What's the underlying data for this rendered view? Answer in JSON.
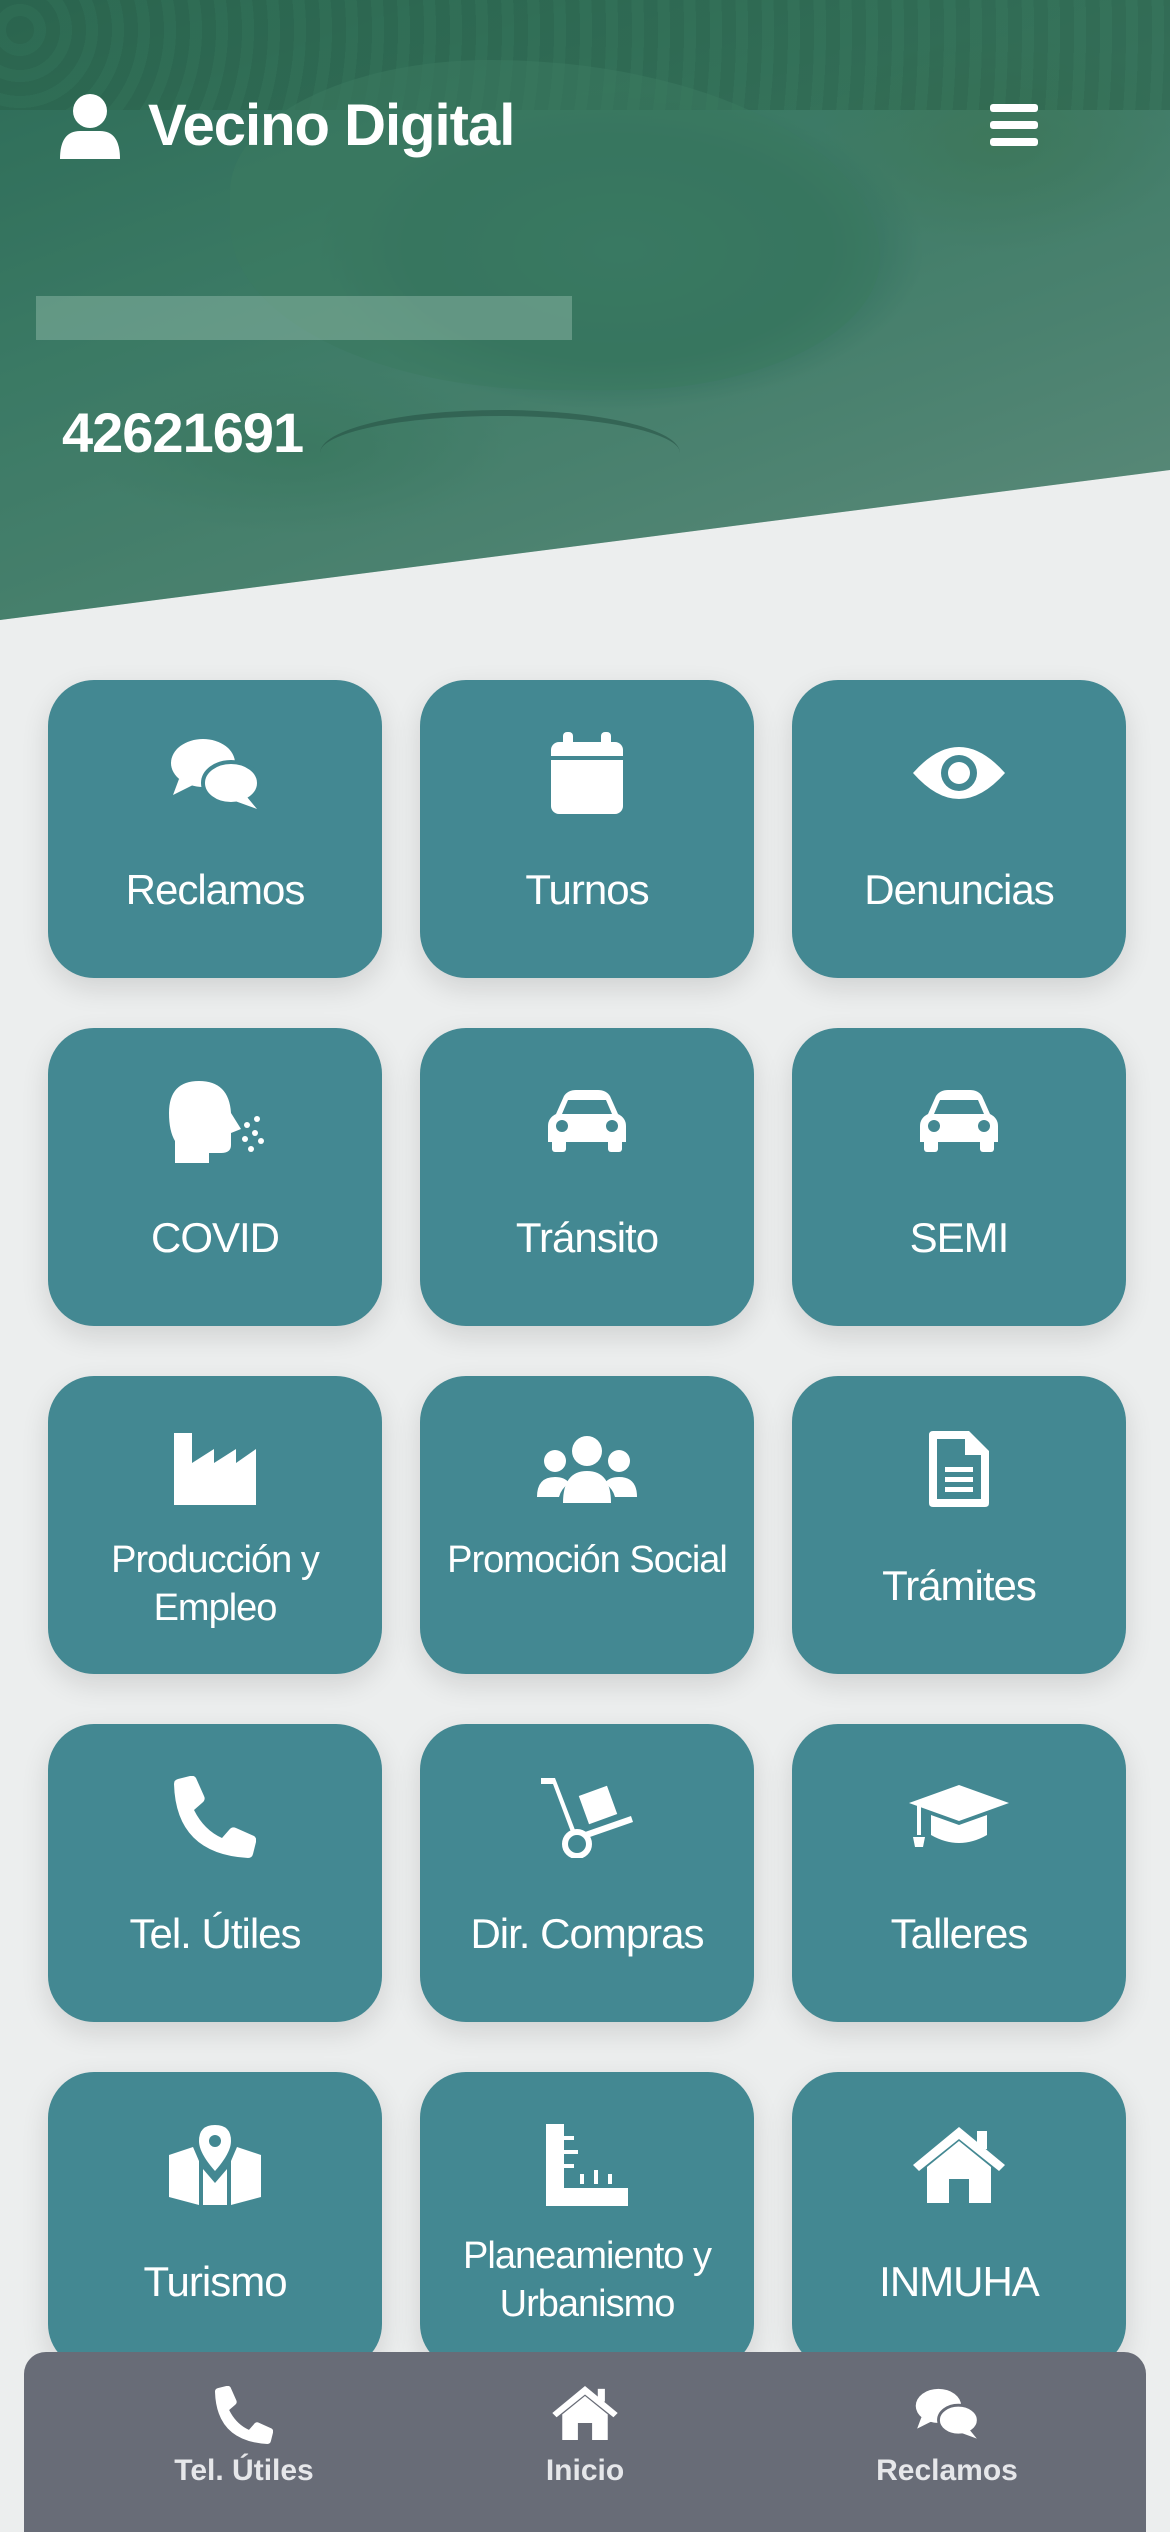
{
  "header": {
    "app_title": "Vecino Digital",
    "user_icon": "user-icon",
    "menu_icon": "hamburger-menu-icon",
    "user_id": "42621691"
  },
  "tiles": [
    {
      "label": "Reclamos",
      "icon": "comments-icon"
    },
    {
      "label": "Turnos",
      "icon": "calendar-icon"
    },
    {
      "label": "Denuncias",
      "icon": "eye-icon"
    },
    {
      "label": "COVID",
      "icon": "head-sneeze-icon"
    },
    {
      "label": "Tránsito",
      "icon": "car-icon"
    },
    {
      "label": "SEMI",
      "icon": "car-icon"
    },
    {
      "label": "Producción y Empleo",
      "icon": "industry-icon"
    },
    {
      "label": "Promoción Social",
      "icon": "users-icon"
    },
    {
      "label": "Trámites",
      "icon": "file-icon"
    },
    {
      "label": "Tel. Útiles",
      "icon": "phone-icon"
    },
    {
      "label": "Dir. Compras",
      "icon": "dolly-icon"
    },
    {
      "label": "Talleres",
      "icon": "graduation-cap-icon"
    },
    {
      "label": "Turismo",
      "icon": "map-marked-icon"
    },
    {
      "label": "Planeamiento y Urbanismo",
      "icon": "ruler-icon"
    },
    {
      "label": "INMUHA",
      "icon": "home-icon"
    }
  ],
  "bottom_nav": [
    {
      "label": "Tel. Útiles",
      "icon": "phone-icon"
    },
    {
      "label": "Inicio",
      "icon": "home-icon"
    },
    {
      "label": "Reclamos",
      "icon": "comments-icon"
    }
  ],
  "colors": {
    "tile": "#438892",
    "background": "#eceeee",
    "bottom_nav": "#686c77"
  }
}
